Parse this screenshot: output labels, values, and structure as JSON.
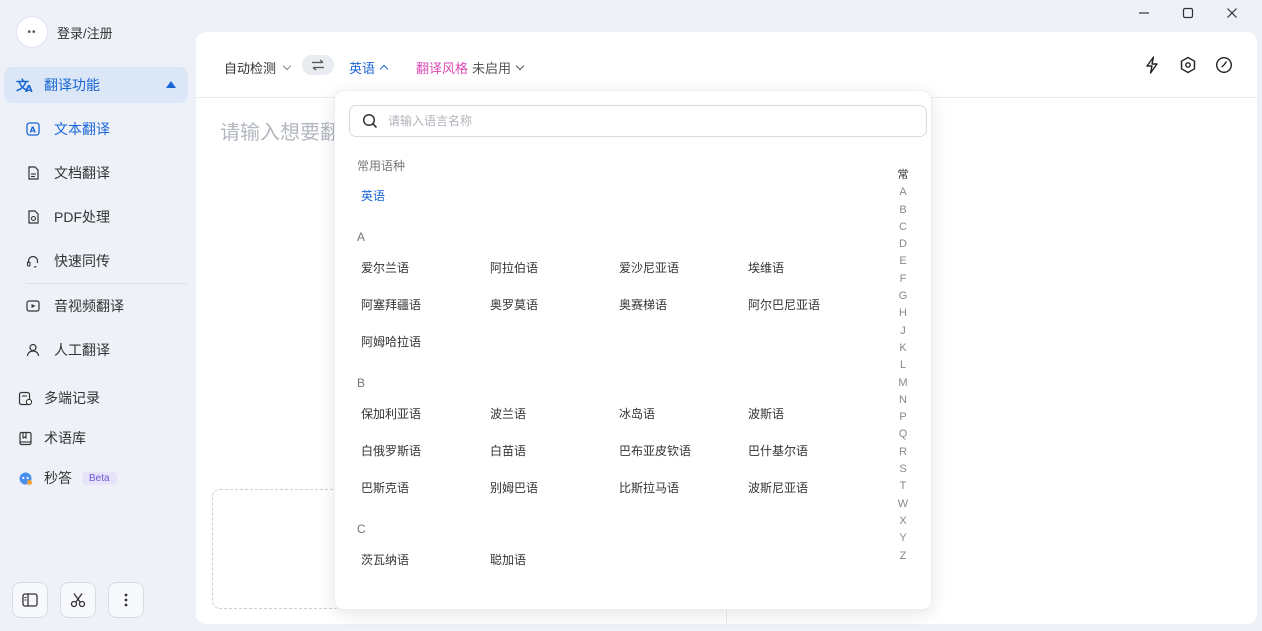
{
  "window": {
    "minimize": "—",
    "maximize": "▢",
    "close": "✕"
  },
  "user": {
    "avatar_text": "••",
    "login_label": "登录/注册"
  },
  "sidebar": {
    "section_label": "翻译功能",
    "sub_items": [
      {
        "label": "文本翻译",
        "icon": "text-translate-icon",
        "active": true
      },
      {
        "label": "文档翻译",
        "icon": "document-icon",
        "active": false
      },
      {
        "label": "PDF处理",
        "icon": "pdf-icon",
        "active": false
      },
      {
        "label": "快速同传",
        "icon": "headset-icon",
        "active": false
      },
      {
        "label": "音视频翻译",
        "icon": "video-icon",
        "active": false
      },
      {
        "label": "人工翻译",
        "icon": "person-icon",
        "active": false
      }
    ],
    "main_items": [
      {
        "label": "多端记录",
        "icon": "record-icon"
      },
      {
        "label": "术语库",
        "icon": "book-icon"
      },
      {
        "label": "秒答",
        "icon": "bot-icon",
        "badge": "Beta"
      }
    ],
    "accent_color": "#1a66d6"
  },
  "toolbar": {
    "source_lang": "自动检测",
    "target_lang": "英语",
    "style_label": "翻译风格",
    "style_value": "未启用"
  },
  "editor": {
    "placeholder": "请输入想要翻"
  },
  "dropdown": {
    "search_placeholder": "请输入语言名称",
    "common_title": "常用语种",
    "common_items": [
      "英语"
    ],
    "sections": [
      {
        "letter": "A",
        "items": [
          "爱尔兰语",
          "阿拉伯语",
          "爱沙尼亚语",
          "埃维语",
          "阿塞拜疆语",
          "奥罗莫语",
          "奥赛梯语",
          "阿尔巴尼亚语",
          "阿姆哈拉语"
        ]
      },
      {
        "letter": "B",
        "items": [
          "保加利亚语",
          "波兰语",
          "冰岛语",
          "波斯语",
          "白俄罗斯语",
          "白苗语",
          "巴布亚皮钦语",
          "巴什基尔语",
          "巴斯克语",
          "别姆巴语",
          "比斯拉马语",
          "波斯尼亚语"
        ]
      },
      {
        "letter": "C",
        "items": [
          "茨瓦纳语",
          "聪加语"
        ]
      }
    ],
    "alphabet": [
      "常",
      "A",
      "B",
      "C",
      "D",
      "E",
      "F",
      "G",
      "H",
      "J",
      "K",
      "L",
      "M",
      "N",
      "P",
      "Q",
      "R",
      "S",
      "T",
      "W",
      "X",
      "Y",
      "Z"
    ]
  }
}
